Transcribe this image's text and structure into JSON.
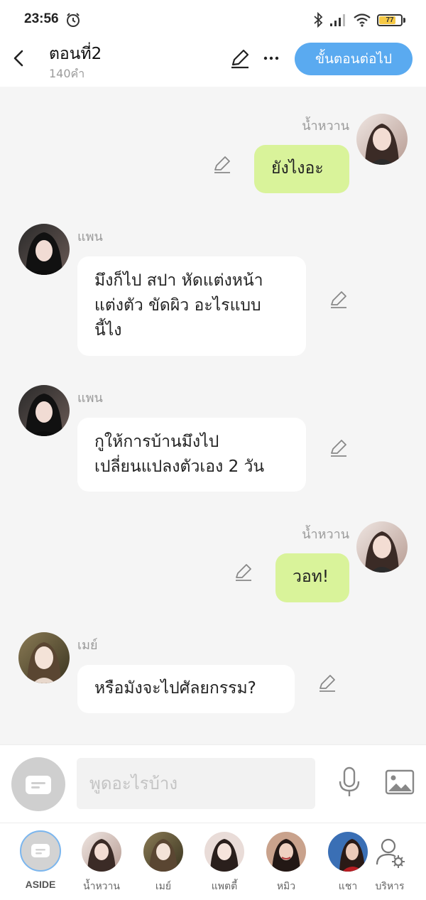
{
  "status_bar": {
    "time": "23:56",
    "battery_level": 77,
    "battery_text": "77"
  },
  "header": {
    "title": "ตอนที่2",
    "word_count": "140คำ",
    "next_button": "ขั้นตอนต่อไป"
  },
  "messages": [
    {
      "side": "right",
      "sender": "น้ำหวาน",
      "text": [
        "ยังไงอะ"
      ]
    },
    {
      "side": "left",
      "sender": "แพน",
      "text": [
        "มึงก็ไป สปา หัดแต่งหน้า",
        "แต่งตัว ขัดผิว อะไรแบบ",
        "นี้ไง"
      ]
    },
    {
      "side": "left",
      "sender": "แพน",
      "text": [
        "กูให้การบ้านมึงไป",
        "เปลี่ยนแปลงตัวเอง 2 วัน"
      ]
    },
    {
      "side": "right",
      "sender": "น้ำหวาน",
      "text": [
        "วอท!"
      ]
    },
    {
      "side": "left",
      "sender": "เมย์",
      "text": [
        "หรือมังจะไปศัลยกรรม?"
      ]
    }
  ],
  "input": {
    "placeholder": "พูดอะไรบ้าง"
  },
  "bottom_nav": [
    {
      "label": "ASIDE",
      "active": true
    },
    {
      "label": "น้ำหวาน"
    },
    {
      "label": "เมย์"
    },
    {
      "label": "แพตตี้"
    },
    {
      "label": "หมิว"
    },
    {
      "label": "แชา"
    },
    {
      "label": "บริหาร",
      "icon": "user-settings-icon"
    }
  ],
  "colors": {
    "accent": "#5aaaf0",
    "right_bubble": "#d9f39a",
    "left_bubble": "#ffffff",
    "background": "#f5f5f5"
  }
}
